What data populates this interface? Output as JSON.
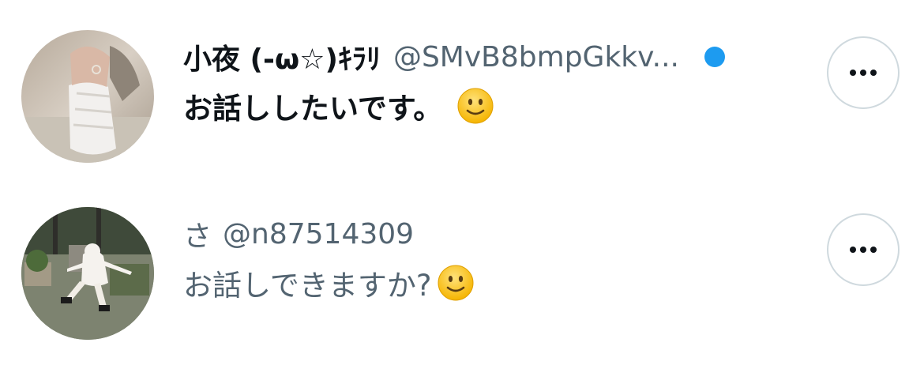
{
  "conversations": [
    {
      "display_name": "小夜 (-ω☆)ｷﾗﾘ",
      "handle": "@SMvB8bmpGkkv...",
      "message": "お話ししたいです。",
      "emoji": "slightly-smiling-face",
      "unread": true
    },
    {
      "display_name": "さ",
      "handle": "@n87514309",
      "message": "お話しできますか?",
      "emoji": "slightly-smiling-face",
      "unread": false
    }
  ],
  "colors": {
    "unread_dot": "#1d9bf0",
    "primary_text": "#0f1419",
    "secondary_text": "#536471",
    "button_border": "#cfd9de"
  }
}
